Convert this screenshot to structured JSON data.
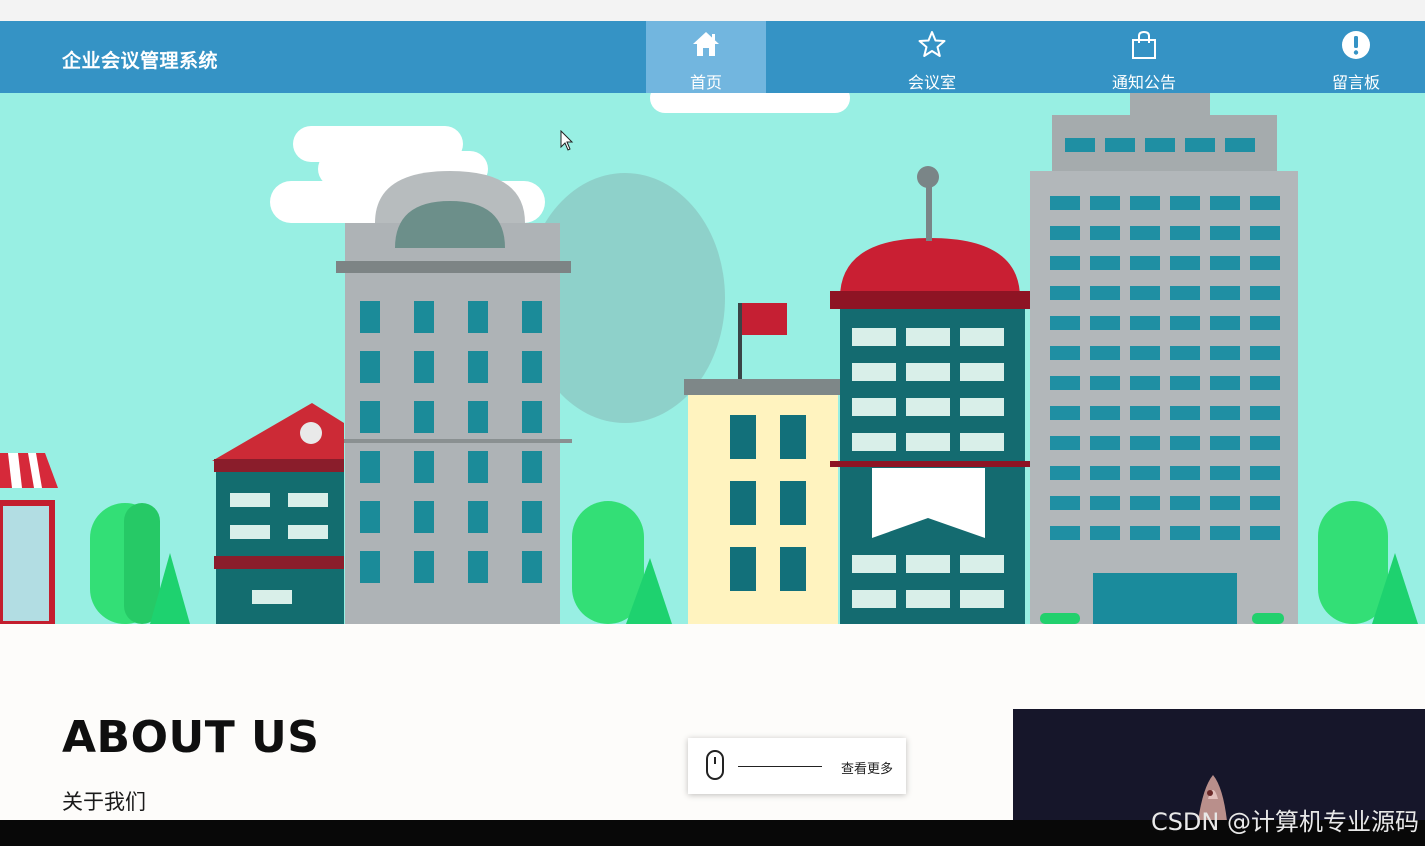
{
  "app": {
    "title": "企业会议管理系统"
  },
  "nav": {
    "items": [
      {
        "label": "首页",
        "icon": "home-icon",
        "active": true
      },
      {
        "label": "会议室",
        "icon": "star-icon",
        "active": false
      },
      {
        "label": "通知公告",
        "icon": "shopping-bag-icon",
        "active": false
      },
      {
        "label": "留言板",
        "icon": "exclamation-circle-icon",
        "active": false
      }
    ]
  },
  "banner": {
    "slide_count": 3,
    "active_slide": 1
  },
  "about": {
    "title": "ABOUT US",
    "subtitle": "关于我们"
  },
  "more": {
    "label": "查看更多",
    "icon": "mouse-scroll-icon"
  },
  "watermark": "CSDN @计算机专业源码",
  "colors": {
    "nav_bg": "#3593c5",
    "nav_active": "#72b6df",
    "banner_sky": "#98efe3"
  }
}
